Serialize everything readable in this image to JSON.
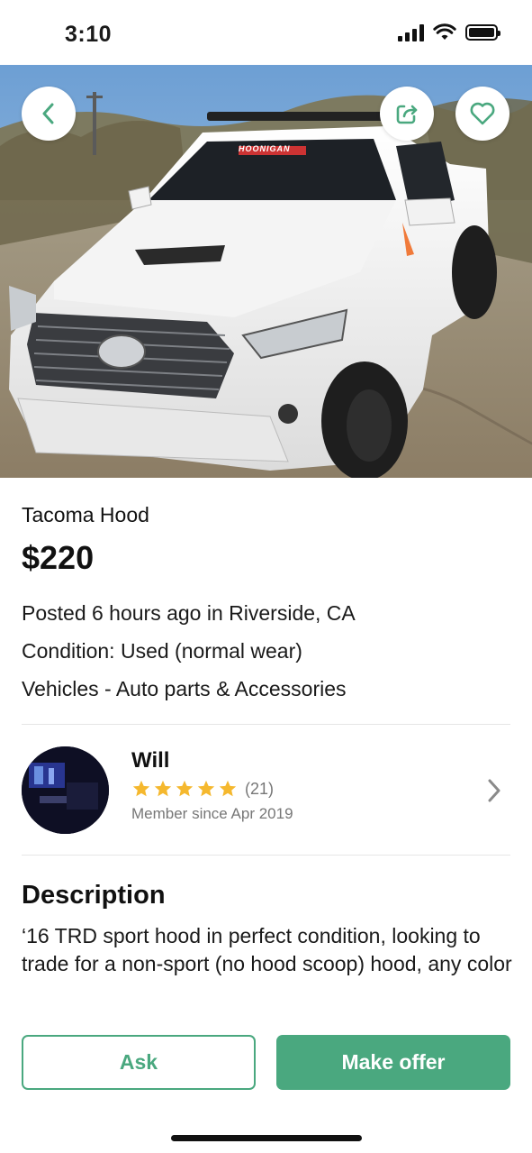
{
  "status_bar": {
    "time": "3:10",
    "signal_icon": "cellular-signal-icon",
    "wifi_icon": "wifi-icon",
    "battery_icon": "battery-icon"
  },
  "hero": {
    "photo_label": "white truck photo",
    "truck_sticker": "HOONIGAN",
    "back_icon": "chevron-left-icon",
    "share_icon": "share-icon",
    "favorite_icon": "heart-icon"
  },
  "listing": {
    "title": "Tacoma Hood",
    "price": "$220",
    "posted": "Posted 6 hours ago in Riverside, CA",
    "condition": "Condition: Used (normal wear)",
    "category": "Vehicles - Auto parts & Accessories"
  },
  "seller": {
    "name": "Will",
    "rating_stars": 5,
    "rating_count": "(21)",
    "member_since": "Member since Apr 2019"
  },
  "description": {
    "heading": "Description",
    "body": "‘16 TRD sport hood in perfect condition, looking to trade for a non-sport (no hood scoop) hood, any color"
  },
  "actions": {
    "ask_label": "Ask",
    "offer_label": "Make offer"
  },
  "colors": {
    "accent": "#4aa87f",
    "star": "#f5b82e",
    "muted_text": "#777777"
  }
}
